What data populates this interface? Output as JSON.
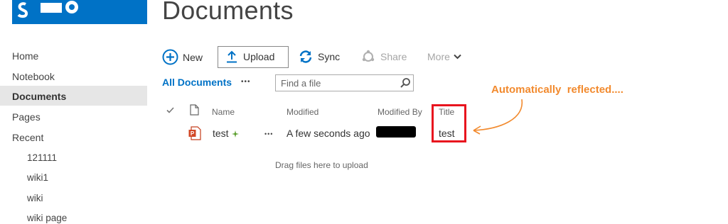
{
  "header": {
    "title": "Documents"
  },
  "sidebar": {
    "items": [
      {
        "label": "Home"
      },
      {
        "label": "Notebook"
      },
      {
        "label": "Documents"
      },
      {
        "label": "Pages"
      },
      {
        "label": "Recent"
      }
    ],
    "recent": [
      {
        "label": "121111"
      },
      {
        "label": "wiki1"
      },
      {
        "label": "wiki"
      },
      {
        "label": "wiki page"
      }
    ]
  },
  "toolbar": {
    "new_label": "New",
    "upload_label": "Upload",
    "sync_label": "Sync",
    "share_label": "Share",
    "more_label": "More"
  },
  "view": {
    "all_documents": "All Documents",
    "ellipsis": "•••",
    "search_placeholder": "Find a file"
  },
  "table": {
    "columns": {
      "name": "Name",
      "modified": "Modified",
      "modified_by": "Modified By",
      "title": "Title"
    },
    "rows": [
      {
        "name": "test",
        "ellipsis": "•••",
        "modified": "A few seconds ago",
        "title": "test"
      }
    ],
    "drag_text": "Drag files here to upload"
  },
  "annotation": {
    "text": "Automatically  reflected...."
  },
  "colors": {
    "brand": "#0072c6",
    "highlight": "#e8141e",
    "annotation": "#f28a2e"
  }
}
